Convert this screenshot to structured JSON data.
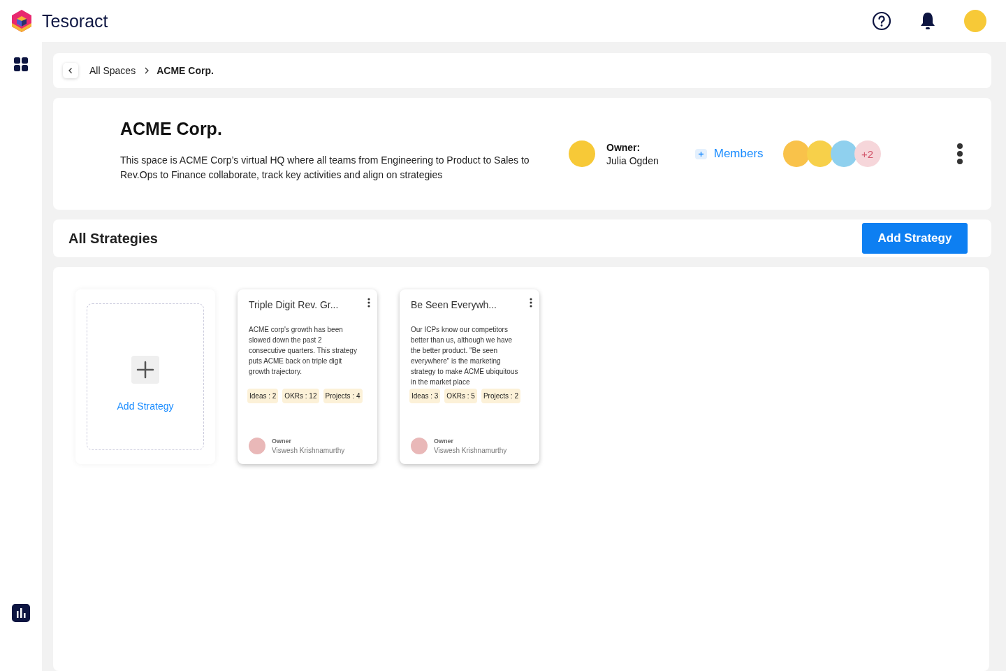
{
  "brand": {
    "name": "Tesoract"
  },
  "breadcrumb": {
    "items": [
      "All Spaces",
      "ACME Corp."
    ]
  },
  "space": {
    "title": "ACME Corp.",
    "description": "This space is ACME Corp’s virtual HQ where all teams from Engineering to Product to Sales to Rev.Ops to Finance collaborate, track key activities and align on strategies",
    "owner_label": "Owner:",
    "owner_name": "Julia Ogden",
    "members_label": "Members",
    "members": [
      {
        "color": "#f9c24a"
      },
      {
        "color": "#f7d04a"
      },
      {
        "color": "#8fd0ee"
      }
    ],
    "members_more": "+2"
  },
  "strategies": {
    "title": "All Strategies",
    "add_button": "Add Strategy",
    "add_tile_label": "Add Strategy",
    "cards": [
      {
        "title": "Triple Digit Rev. Gr...",
        "description": "ACME corp's growth has been slowed down the past 2 consecutive quarters. This strategy puts ACME back on triple digit growth trajectory.",
        "tags": [
          "Ideas : 2",
          "OKRs : 12",
          "Projects : 4"
        ],
        "owner_label": "Owner",
        "owner_name": "Viswesh Krishnamurthy"
      },
      {
        "title": "Be Seen Everywh...",
        "description": "Our ICPs know our competitors better than us, although we have the better product. \"Be seen everywhere\" is the marketing strategy to make ACME ubiquitous in the market place",
        "tags": [
          "Ideas : 3",
          "OKRs : 5",
          "Projects : 2"
        ],
        "owner_label": "Owner",
        "owner_name": "Viswesh Krishnamurthy"
      }
    ]
  }
}
